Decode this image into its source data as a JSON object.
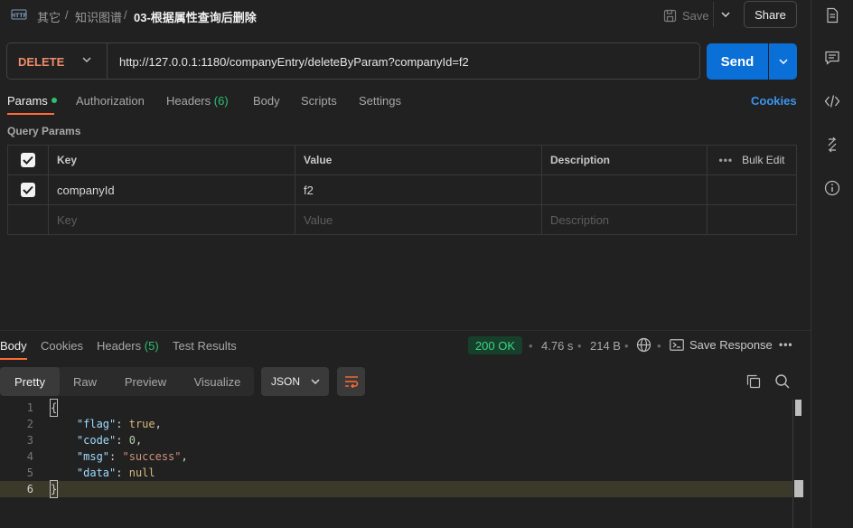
{
  "breadcrumb": {
    "part1": "其它",
    "sep": "/",
    "part2": "知识图谱",
    "current": "03-根据属性查询后删除"
  },
  "toolbar": {
    "save_label": "Save",
    "share_label": "Share"
  },
  "request": {
    "method": "DELETE",
    "url": "http://127.0.0.1:1180/companyEntry/deleteByParam?companyId=f2",
    "send_label": "Send"
  },
  "tabs": {
    "params": "Params",
    "authorization": "Authorization",
    "headers": "Headers",
    "headers_count": "(6)",
    "body": "Body",
    "scripts": "Scripts",
    "settings": "Settings",
    "cookies": "Cookies"
  },
  "query_params": {
    "title": "Query Params",
    "columns": {
      "key": "Key",
      "value": "Value",
      "description": "Description",
      "bulk_edit": "Bulk Edit"
    },
    "rows": [
      {
        "checked": true,
        "key": "companyId",
        "value": "f2",
        "description": ""
      }
    ],
    "placeholder": {
      "key": "Key",
      "value": "Value",
      "description": "Description"
    }
  },
  "response": {
    "tabs": {
      "body": "Body",
      "cookies": "Cookies",
      "headers": "Headers",
      "headers_count": "(5)",
      "test_results": "Test Results"
    },
    "status": "200 OK",
    "time": "4.76 s",
    "size": "214 B",
    "save_response": "Save Response",
    "views": {
      "pretty": "Pretty",
      "raw": "Raw",
      "preview": "Preview",
      "visualize": "Visualize"
    },
    "format": "JSON",
    "code_lines": {
      "l1": "{",
      "flag_key": "\"flag\"",
      "flag_val": "true",
      "code_key": "\"code\"",
      "code_val": "0",
      "msg_key": "\"msg\"",
      "msg_val": "\"success\"",
      "data_key": "\"data\"",
      "data_val": "null",
      "l6": "}"
    },
    "line_numbers": [
      "1",
      "2",
      "3",
      "4",
      "5",
      "6"
    ]
  },
  "colors": {
    "accent": "#ff6c37",
    "send": "#0a6fd6",
    "method": "#ee8c6a",
    "status_ok": "#3fd583",
    "link": "#3b95f0"
  }
}
